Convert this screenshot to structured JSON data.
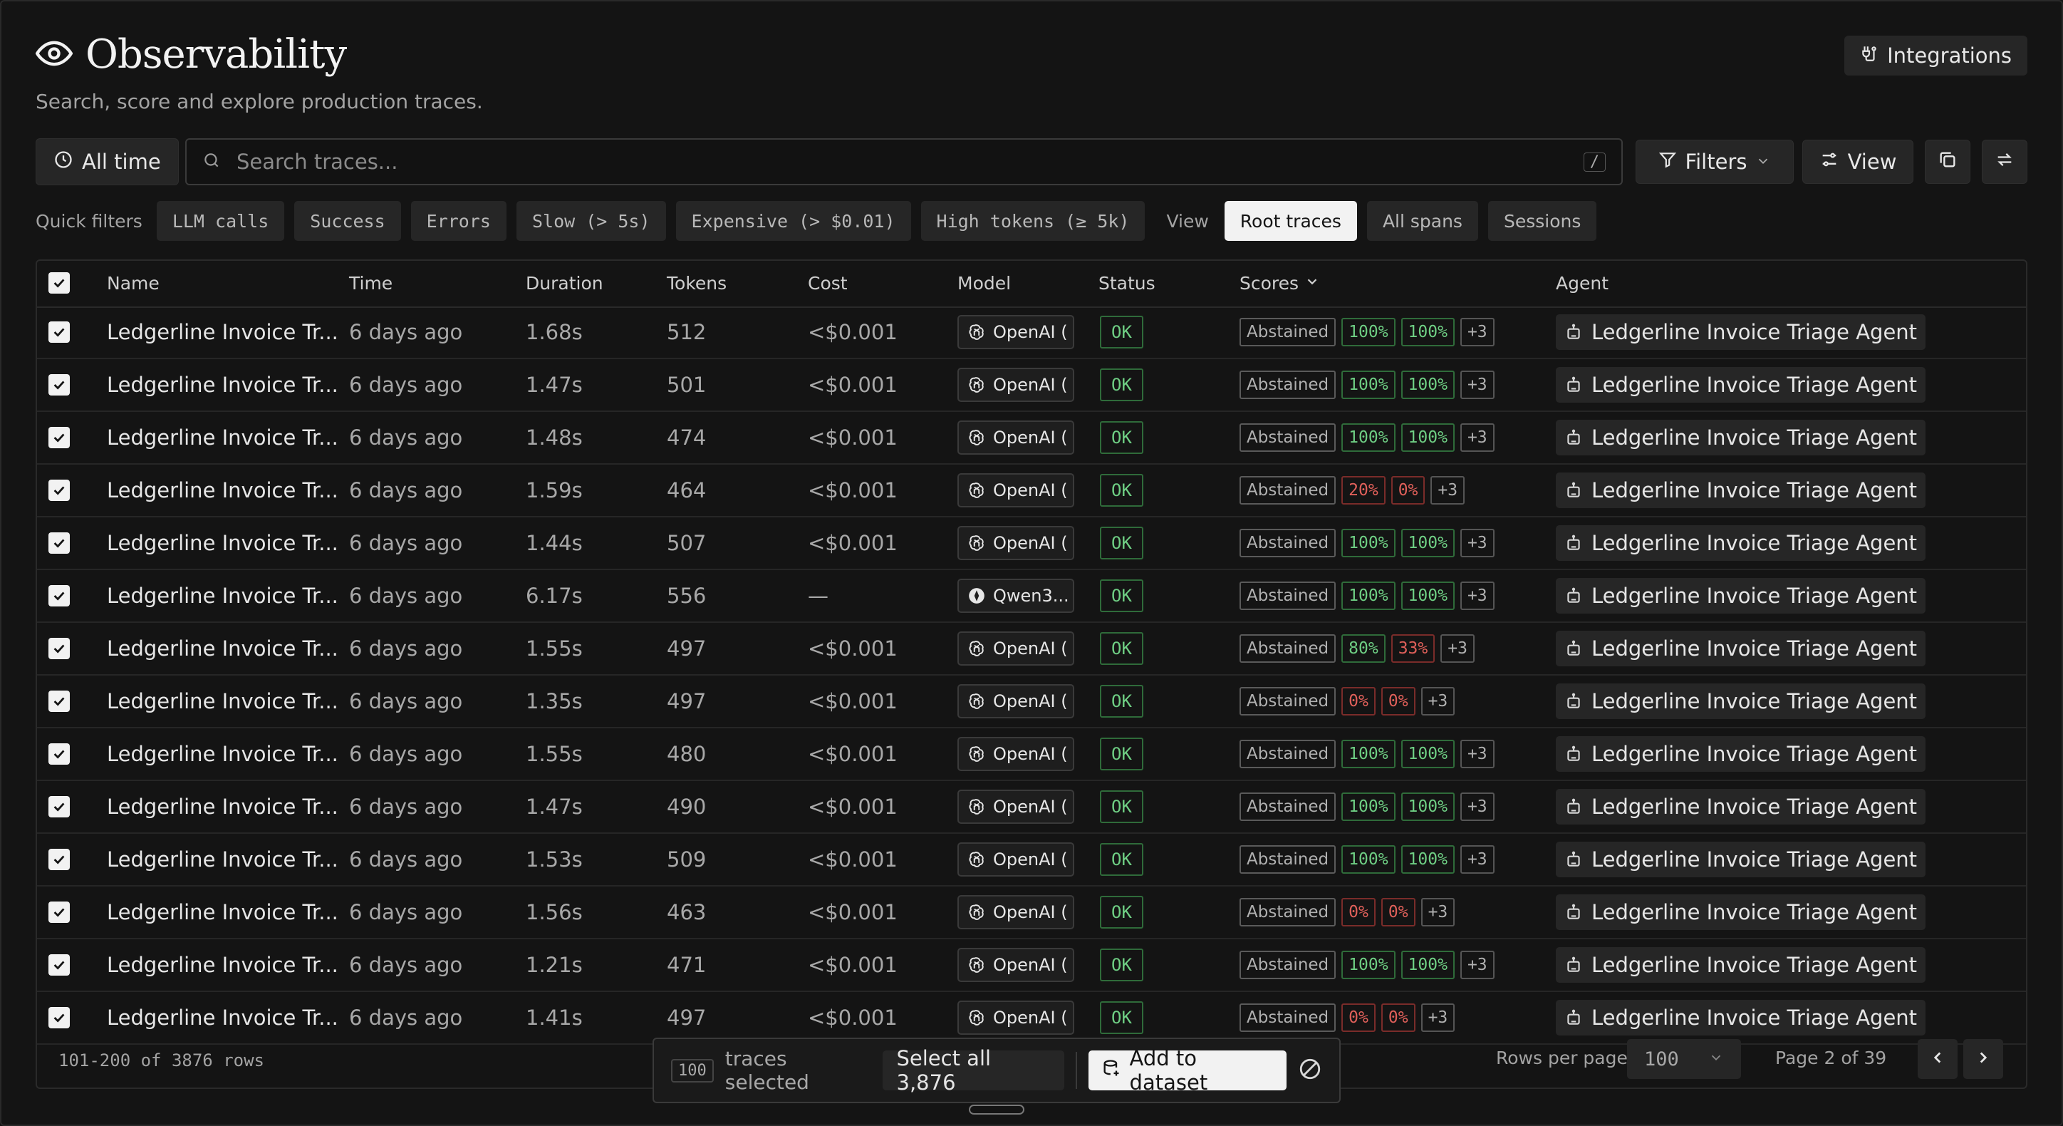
{
  "header": {
    "title": "Observability",
    "subtitle": "Search, score and explore production traces.",
    "integrations_label": "Integrations"
  },
  "toolbar": {
    "time_range_label": "All time",
    "search_placeholder": "Search traces...",
    "search_shortcut": "/",
    "filters_label": "Filters",
    "view_label": "View"
  },
  "quick_filters": {
    "label": "Quick filters",
    "items": [
      "LLM calls",
      "Success",
      "Errors",
      "Slow (> 5s)",
      "Expensive (> $0.01)",
      "High tokens (≥ 5k)"
    ],
    "view_label": "View",
    "views": [
      "Root traces",
      "All spans",
      "Sessions"
    ],
    "active_view": "Root traces"
  },
  "table": {
    "columns": [
      "Name",
      "Time",
      "Duration",
      "Tokens",
      "Cost",
      "Model",
      "Status",
      "Scores",
      "Agent"
    ],
    "rows": [
      {
        "name": "Ledgerline Invoice Tr...",
        "time": "6 days ago",
        "duration": "1.68s",
        "tokens": "512",
        "cost": "<$0.001",
        "model": "OpenAI (",
        "model_icon": "openai-icon",
        "status": "OK",
        "scores": [
          {
            "text": "Abstained",
            "kind": "abst"
          },
          {
            "text": "100%",
            "kind": "good"
          },
          {
            "text": "100%",
            "kind": "good"
          },
          {
            "text": "+3",
            "kind": "more"
          }
        ],
        "agent": "Ledgerline Invoice Triage Agent"
      },
      {
        "name": "Ledgerline Invoice Tr...",
        "time": "6 days ago",
        "duration": "1.47s",
        "tokens": "501",
        "cost": "<$0.001",
        "model": "OpenAI (",
        "model_icon": "openai-icon",
        "status": "OK",
        "scores": [
          {
            "text": "Abstained",
            "kind": "abst"
          },
          {
            "text": "100%",
            "kind": "good"
          },
          {
            "text": "100%",
            "kind": "good"
          },
          {
            "text": "+3",
            "kind": "more"
          }
        ],
        "agent": "Ledgerline Invoice Triage Agent"
      },
      {
        "name": "Ledgerline Invoice Tr...",
        "time": "6 days ago",
        "duration": "1.48s",
        "tokens": "474",
        "cost": "<$0.001",
        "model": "OpenAI (",
        "model_icon": "openai-icon",
        "status": "OK",
        "scores": [
          {
            "text": "Abstained",
            "kind": "abst"
          },
          {
            "text": "100%",
            "kind": "good"
          },
          {
            "text": "100%",
            "kind": "good"
          },
          {
            "text": "+3",
            "kind": "more"
          }
        ],
        "agent": "Ledgerline Invoice Triage Agent"
      },
      {
        "name": "Ledgerline Invoice Tr...",
        "time": "6 days ago",
        "duration": "1.59s",
        "tokens": "464",
        "cost": "<$0.001",
        "model": "OpenAI (",
        "model_icon": "openai-icon",
        "status": "OK",
        "scores": [
          {
            "text": "Abstained",
            "kind": "abst"
          },
          {
            "text": "20%",
            "kind": "bad"
          },
          {
            "text": "0%",
            "kind": "bad"
          },
          {
            "text": "+3",
            "kind": "more"
          }
        ],
        "agent": "Ledgerline Invoice Triage Agent"
      },
      {
        "name": "Ledgerline Invoice Tr...",
        "time": "6 days ago",
        "duration": "1.44s",
        "tokens": "507",
        "cost": "<$0.001",
        "model": "OpenAI (",
        "model_icon": "openai-icon",
        "status": "OK",
        "scores": [
          {
            "text": "Abstained",
            "kind": "abst"
          },
          {
            "text": "100%",
            "kind": "good"
          },
          {
            "text": "100%",
            "kind": "good"
          },
          {
            "text": "+3",
            "kind": "more"
          }
        ],
        "agent": "Ledgerline Invoice Triage Agent"
      },
      {
        "name": "Ledgerline Invoice Tr...",
        "time": "6 days ago",
        "duration": "6.17s",
        "tokens": "556",
        "cost": "—",
        "model": "Qwen3...",
        "model_icon": "qwen-icon",
        "status": "OK",
        "scores": [
          {
            "text": "Abstained",
            "kind": "abst"
          },
          {
            "text": "100%",
            "kind": "good"
          },
          {
            "text": "100%",
            "kind": "good"
          },
          {
            "text": "+3",
            "kind": "more"
          }
        ],
        "agent": "Ledgerline Invoice Triage Agent"
      },
      {
        "name": "Ledgerline Invoice Tr...",
        "time": "6 days ago",
        "duration": "1.55s",
        "tokens": "497",
        "cost": "<$0.001",
        "model": "OpenAI (",
        "model_icon": "openai-icon",
        "status": "OK",
        "scores": [
          {
            "text": "Abstained",
            "kind": "abst"
          },
          {
            "text": "80%",
            "kind": "good"
          },
          {
            "text": "33%",
            "kind": "bad"
          },
          {
            "text": "+3",
            "kind": "more"
          }
        ],
        "agent": "Ledgerline Invoice Triage Agent"
      },
      {
        "name": "Ledgerline Invoice Tr...",
        "time": "6 days ago",
        "duration": "1.35s",
        "tokens": "497",
        "cost": "<$0.001",
        "model": "OpenAI (",
        "model_icon": "openai-icon",
        "status": "OK",
        "scores": [
          {
            "text": "Abstained",
            "kind": "abst"
          },
          {
            "text": "0%",
            "kind": "bad"
          },
          {
            "text": "0%",
            "kind": "bad"
          },
          {
            "text": "+3",
            "kind": "more"
          }
        ],
        "agent": "Ledgerline Invoice Triage Agent"
      },
      {
        "name": "Ledgerline Invoice Tr...",
        "time": "6 days ago",
        "duration": "1.55s",
        "tokens": "480",
        "cost": "<$0.001",
        "model": "OpenAI (",
        "model_icon": "openai-icon",
        "status": "OK",
        "scores": [
          {
            "text": "Abstained",
            "kind": "abst"
          },
          {
            "text": "100%",
            "kind": "good"
          },
          {
            "text": "100%",
            "kind": "good"
          },
          {
            "text": "+3",
            "kind": "more"
          }
        ],
        "agent": "Ledgerline Invoice Triage Agent"
      },
      {
        "name": "Ledgerline Invoice Tr...",
        "time": "6 days ago",
        "duration": "1.47s",
        "tokens": "490",
        "cost": "<$0.001",
        "model": "OpenAI (",
        "model_icon": "openai-icon",
        "status": "OK",
        "scores": [
          {
            "text": "Abstained",
            "kind": "abst"
          },
          {
            "text": "100%",
            "kind": "good"
          },
          {
            "text": "100%",
            "kind": "good"
          },
          {
            "text": "+3",
            "kind": "more"
          }
        ],
        "agent": "Ledgerline Invoice Triage Agent"
      },
      {
        "name": "Ledgerline Invoice Tr...",
        "time": "6 days ago",
        "duration": "1.53s",
        "tokens": "509",
        "cost": "<$0.001",
        "model": "OpenAI (",
        "model_icon": "openai-icon",
        "status": "OK",
        "scores": [
          {
            "text": "Abstained",
            "kind": "abst"
          },
          {
            "text": "100%",
            "kind": "good"
          },
          {
            "text": "100%",
            "kind": "good"
          },
          {
            "text": "+3",
            "kind": "more"
          }
        ],
        "agent": "Ledgerline Invoice Triage Agent"
      },
      {
        "name": "Ledgerline Invoice Tr...",
        "time": "6 days ago",
        "duration": "1.56s",
        "tokens": "463",
        "cost": "<$0.001",
        "model": "OpenAI (",
        "model_icon": "openai-icon",
        "status": "OK",
        "scores": [
          {
            "text": "Abstained",
            "kind": "abst"
          },
          {
            "text": "0%",
            "kind": "bad"
          },
          {
            "text": "0%",
            "kind": "bad"
          },
          {
            "text": "+3",
            "kind": "more"
          }
        ],
        "agent": "Ledgerline Invoice Triage Agent"
      },
      {
        "name": "Ledgerline Invoice Tr...",
        "time": "6 days ago",
        "duration": "1.21s",
        "tokens": "471",
        "cost": "<$0.001",
        "model": "OpenAI (",
        "model_icon": "openai-icon",
        "status": "OK",
        "scores": [
          {
            "text": "Abstained",
            "kind": "abst"
          },
          {
            "text": "100%",
            "kind": "good"
          },
          {
            "text": "100%",
            "kind": "good"
          },
          {
            "text": "+3",
            "kind": "more"
          }
        ],
        "agent": "Ledgerline Invoice Triage Agent"
      },
      {
        "name": "Ledgerline Invoice Tr...",
        "time": "6 days ago",
        "duration": "1.41s",
        "tokens": "497",
        "cost": "<$0.001",
        "model": "OpenAI (",
        "model_icon": "openai-icon",
        "status": "OK",
        "scores": [
          {
            "text": "Abstained",
            "kind": "abst"
          },
          {
            "text": "0%",
            "kind": "bad"
          },
          {
            "text": "0%",
            "kind": "bad"
          },
          {
            "text": "+3",
            "kind": "more"
          }
        ],
        "agent": "Ledgerline Invoice Triage Agent"
      }
    ]
  },
  "footer": {
    "row_range": "101-200 of 3876 rows",
    "rows_per_page_label": "Rows per page",
    "rows_per_page_value": "100",
    "page_info": "Page 2 of 39"
  },
  "selection_bar": {
    "count": "100",
    "selected_text": "traces selected",
    "select_all_label": "Select all 3,876",
    "add_to_dataset_label": "Add to dataset"
  },
  "colors": {
    "background": "#141414",
    "ok_green": "#6fcf84",
    "bad_red": "#e0605a"
  }
}
